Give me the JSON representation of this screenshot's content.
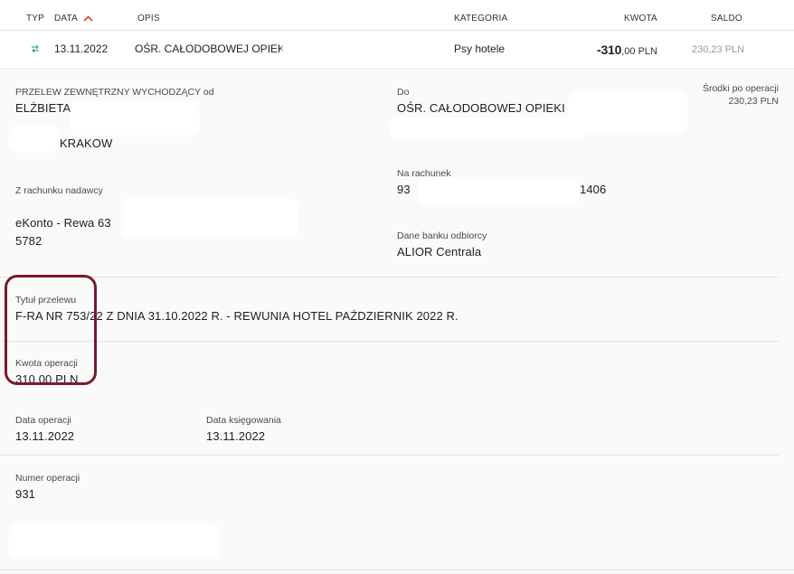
{
  "table": {
    "headers": {
      "typ": "TYP",
      "data": "DATA",
      "opis": "OPIS",
      "kategoria": "KATEGORIA",
      "kwota": "KWOTA",
      "saldo": "SALDO"
    },
    "row": {
      "date": "13.11.2022",
      "opis": "OŚR. CAŁODOBOWEJ OPIEKI",
      "kategoria": "Psy hotele",
      "kwota_major": "-310",
      "kwota_minor": ",00 PLN",
      "saldo": "230,23 PLN"
    }
  },
  "details": {
    "transfer_type_label": "PRZELEW ZEWNĘTRZNY WYCHODZĄCY od",
    "sender_name": "ELŻBIETA ’",
    "sender_city": "KRAKOW",
    "to_label": "Do",
    "recipient_name": "OŚR. CAŁODOBOWEJ OPIEKI",
    "funds_after_label": "Środki po operacji",
    "funds_after_value": "230,23 PLN",
    "to_account_label": "Na rachunek",
    "to_account_prefix": "93",
    "to_account_suffix": "1406",
    "from_account_label": "Z rachunku nadawcy",
    "from_account_name": "eKonto - Rewa 63",
    "from_account_number": "5782",
    "bank_label": "Dane banku odbiorcy",
    "bank_value": "ALIOR Centrala",
    "title_label": "Tytuł przelewu",
    "title_value": "F-RA NR 753/22 Z DNIA 31.10.2022 R. - REWUNIA HOTEL PAŹDZIERNIK 2022 R.",
    "amount_label": "Kwota operacji",
    "amount_value": "310,00 PLN",
    "op_date_label": "Data operacji",
    "op_date_value": "13.11.2022",
    "booking_date_label": "Data księgowania",
    "booking_date_value": "13.11.2022",
    "op_number_label": "Numer operacji",
    "op_number_value": "931"
  },
  "colors": {
    "accent": "#e2231a",
    "transfer_icon": "#3aa05a",
    "highlight": "#7a1a2b"
  }
}
